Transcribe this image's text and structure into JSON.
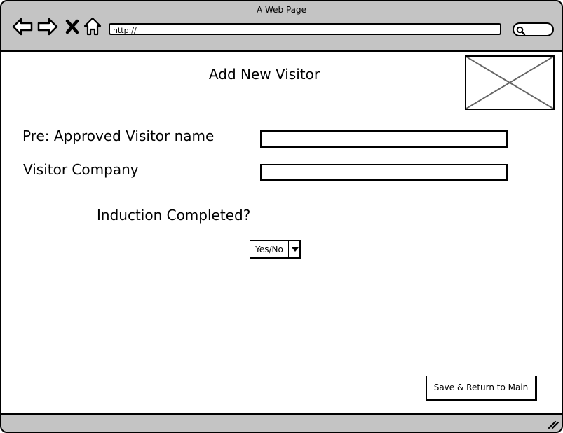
{
  "window": {
    "title": "A Web Page",
    "url": "http://",
    "nav_icons": [
      "back-arrow-icon",
      "forward-arrow-icon",
      "close-icon",
      "home-icon"
    ],
    "search_icon": "search-icon"
  },
  "page": {
    "title": "Add New Visitor",
    "image_placeholder": "image-placeholder-icon"
  },
  "form": {
    "visitor_name_label": "Pre: Approved Visitor name",
    "visitor_name_value": "",
    "company_label": "Visitor Company",
    "company_value": "",
    "induction_label": "Induction Completed?",
    "induction_select_value": "Yes/No"
  },
  "actions": {
    "save_label": "Save & Return to Main"
  },
  "colors": {
    "chrome_gray": "#c4c4c4",
    "border": "#000000",
    "placeholder_cross": "#666666"
  }
}
